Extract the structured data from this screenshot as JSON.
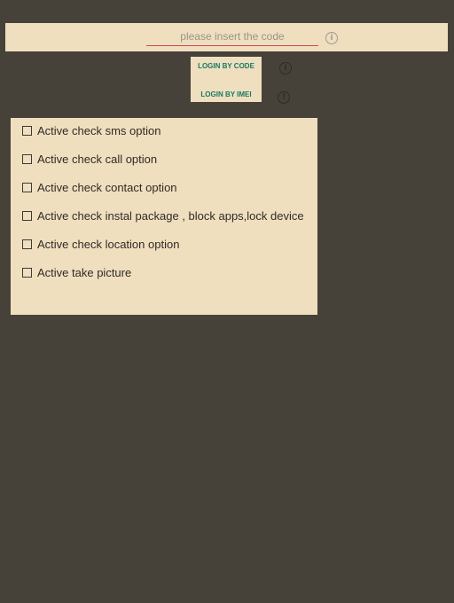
{
  "code_bar": {
    "placeholder": "please insert the code",
    "value": "",
    "info_icon": "info-icon"
  },
  "login": {
    "code_label": "LOGIN BY CODE",
    "imei_label": "LOGIN BY IMEI",
    "info_icon": "info-icon",
    "warning_icon": "warning-icon"
  },
  "options": [
    {
      "label": "Active check sms option",
      "checked": false
    },
    {
      "label": "Active check call option",
      "checked": false
    },
    {
      "label": "Active check contact option",
      "checked": false
    },
    {
      "label": "Active check instal package , block apps,lock device",
      "checked": false
    },
    {
      "label": "Active check location option",
      "checked": false
    },
    {
      "label": "Active take picture",
      "checked": false
    }
  ],
  "colors": {
    "background": "#46423a",
    "panel": "#efdfbf",
    "accent_underline": "#d2435e",
    "button_text": "#167a63"
  }
}
